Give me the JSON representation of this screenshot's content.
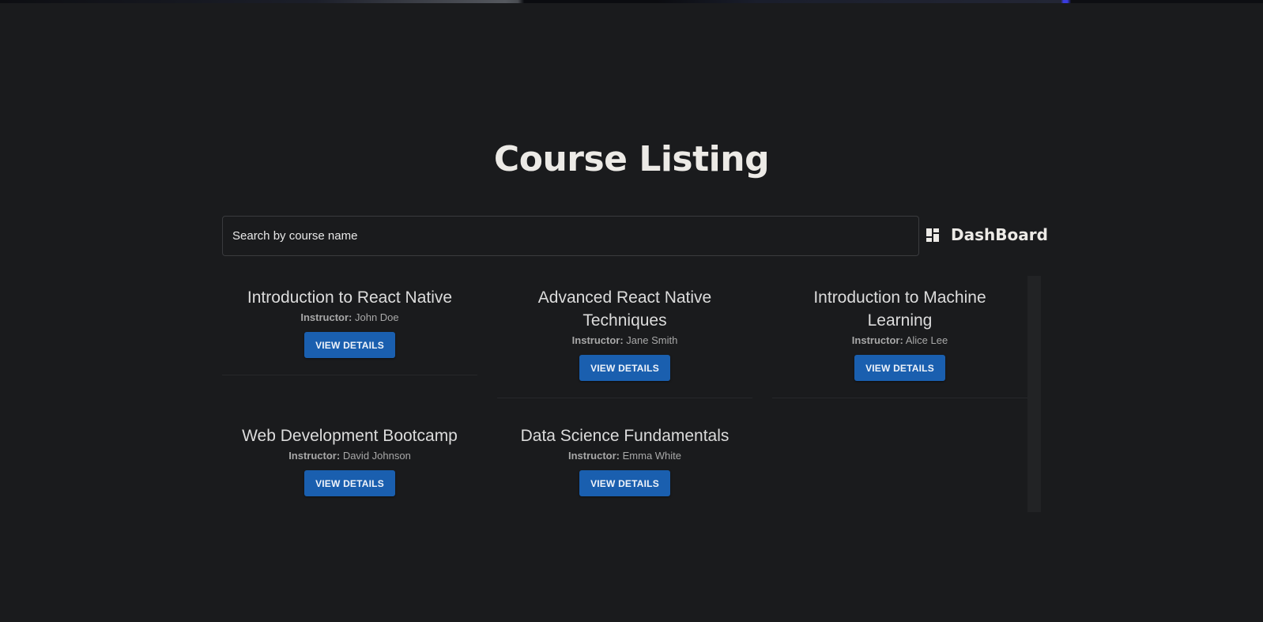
{
  "page": {
    "title": "Course Listing"
  },
  "search": {
    "placeholder": "Search by course name",
    "value": ""
  },
  "nav": {
    "dashboard_label": "DashBoard",
    "dashboard_icon": "dashboard-icon"
  },
  "courses": [
    {
      "title": "Introduction to React Native",
      "instructor_label": "Instructor:",
      "instructor": "John Doe",
      "button": "VIEW DETAILS"
    },
    {
      "title": "Advanced React Native Techniques",
      "instructor_label": "Instructor:",
      "instructor": "Jane Smith",
      "button": "VIEW DETAILS"
    },
    {
      "title": "Introduction to Machine Learning",
      "instructor_label": "Instructor:",
      "instructor": "Alice Lee",
      "button": "VIEW DETAILS"
    },
    {
      "title": "Web Development Bootcamp",
      "instructor_label": "Instructor:",
      "instructor": "David Johnson",
      "button": "VIEW DETAILS"
    },
    {
      "title": "Data Science Fundamentals",
      "instructor_label": "Instructor:",
      "instructor": "Emma White",
      "button": "VIEW DETAILS"
    }
  ],
  "colors": {
    "background": "#1a1b1d",
    "button": "#1a5faf",
    "text": "#eceae6"
  }
}
